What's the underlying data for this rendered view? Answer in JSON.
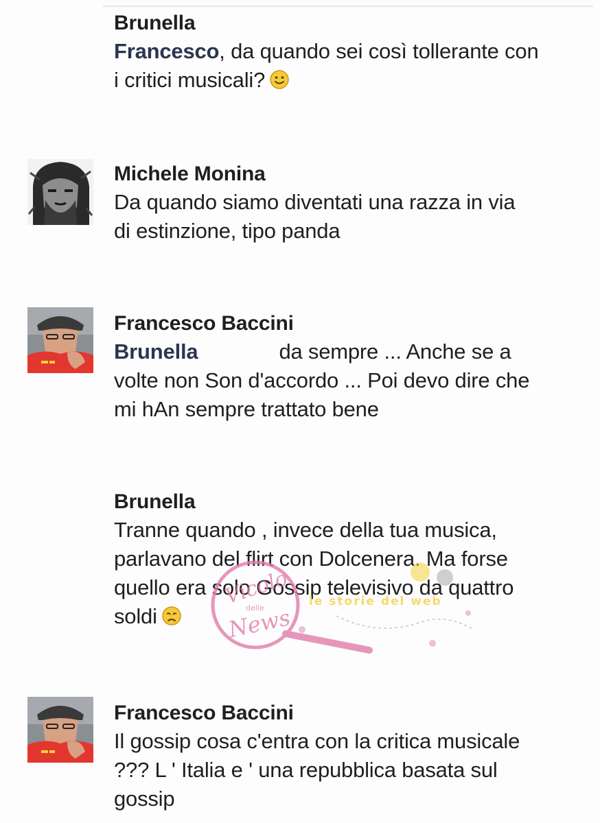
{
  "comments": [
    {
      "author": "Brunella",
      "mention": "Francesco",
      "lines": [
        ", da quando sei così tollerante con",
        "i critici musicali?"
      ],
      "emoji": "smile-emoji"
    },
    {
      "author": "Michele Monina",
      "lines": [
        "Da quando siamo diventati una razza in via",
        "di estinzione, tipo panda"
      ]
    },
    {
      "author": "Francesco Baccini",
      "mention": "Brunella",
      "lines": [
        "da sempre ... Anche se a",
        "volte non Son d'accordo ... Poi devo dire che",
        "mi hAn sempre trattato bene"
      ]
    },
    {
      "author": "Brunella",
      "lines": [
        "Tranne quando , invece della tua musica,",
        "parlavano del flirt con Dolcenera. Ma forse",
        "quello era solo Gossip televisivo da quattro",
        "soldi"
      ],
      "emoji": "sad-emoji"
    },
    {
      "author": "Francesco Baccini",
      "lines": [
        "Il gossip cosa c'entra con la critica musicale",
        "??? L ' Italia e ' una repubblica basata sul",
        "gossip"
      ]
    }
  ],
  "watermark": {
    "brand_top": "Vicolo",
    "brand_small": "delle",
    "brand_bottom": "News",
    "tagline": "le storie del web"
  },
  "colors": {
    "background": "#fdfdfd",
    "text": "#1f1f1f",
    "mention": "#2b3550",
    "watermark_pink": "#e07aa8",
    "watermark_yellow": "#f4d23c"
  }
}
